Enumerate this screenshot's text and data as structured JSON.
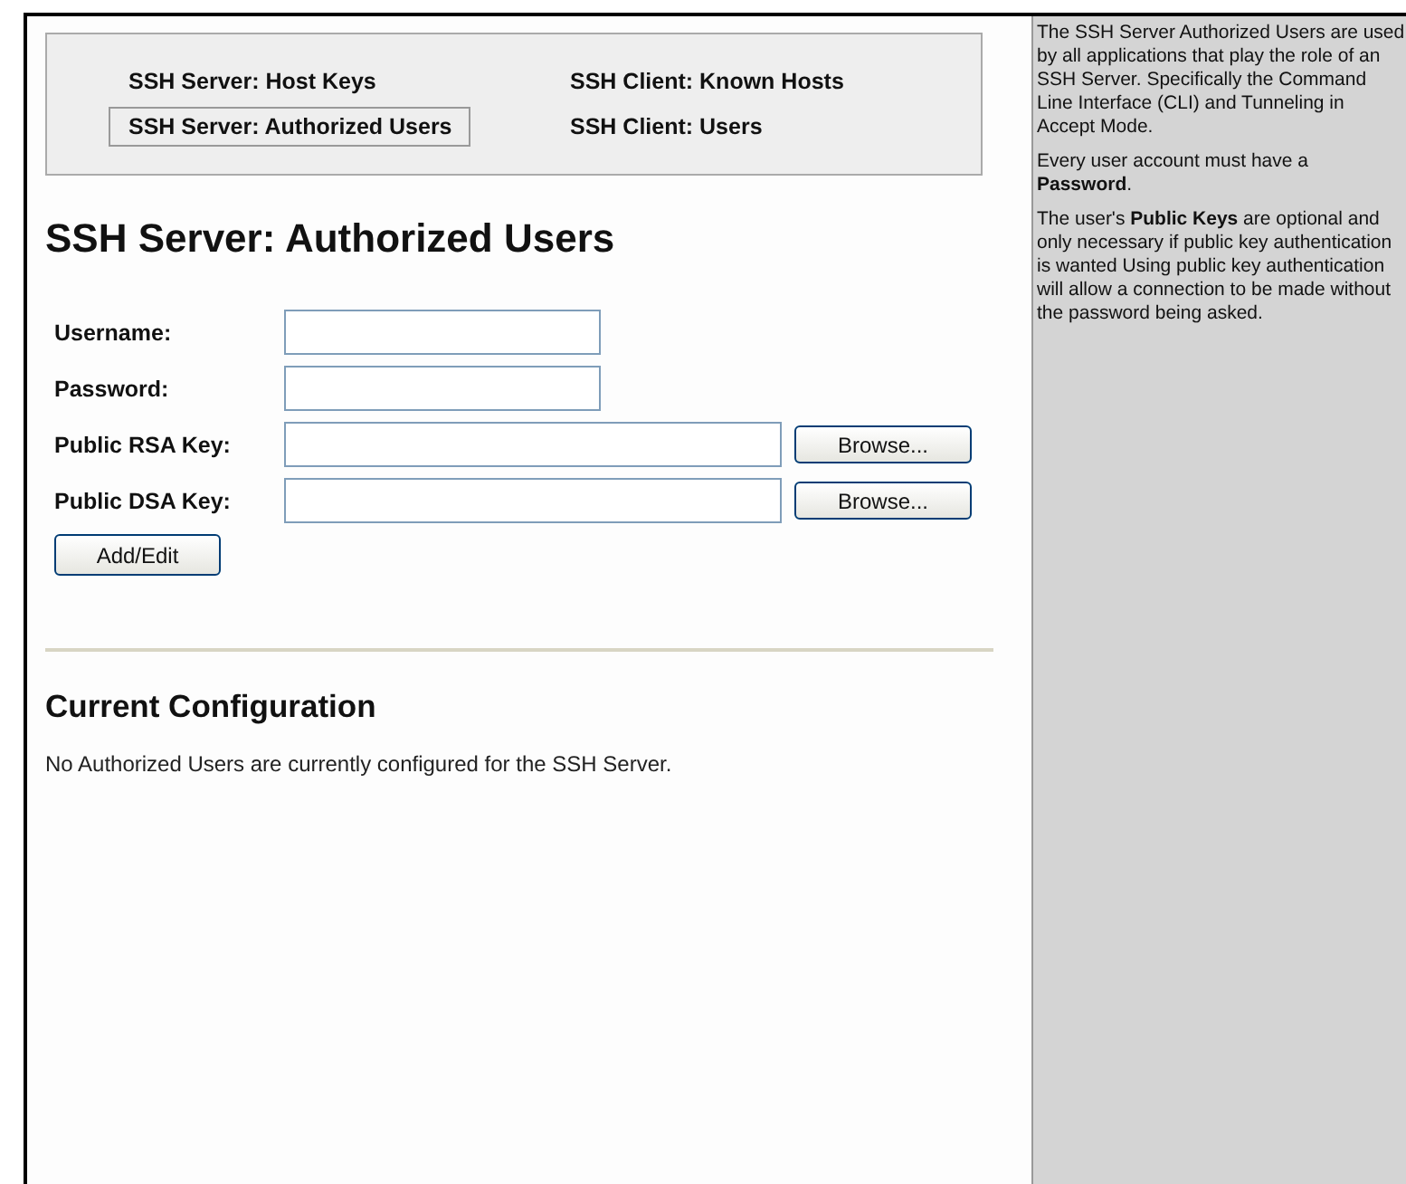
{
  "nav": [
    {
      "label": "SSH Server: Host Keys",
      "selected": false
    },
    {
      "label": "SSH Client: Known Hosts",
      "selected": false
    },
    {
      "label": "SSH Server: Authorized Users",
      "selected": true
    },
    {
      "label": "SSH Client: Users",
      "selected": false
    }
  ],
  "title": "SSH Server: Authorized Users",
  "form": {
    "fields": [
      {
        "label": "Username:",
        "kind": "text"
      },
      {
        "label": "Password:",
        "kind": "password"
      },
      {
        "label": "Public RSA Key:",
        "kind": "file",
        "button": "Browse..."
      },
      {
        "label": "Public DSA Key:",
        "kind": "file",
        "button": "Browse..."
      }
    ],
    "submit": "Add/Edit"
  },
  "config": {
    "heading": "Current Configuration",
    "message": "No Authorized Users are currently configured for the SSH Server."
  },
  "help": [
    "The SSH Server Authorized Users are used by all applications that play the role of an SSH Server. Specifically the Command Line Interface (CLI) and Tunneling in Accept Mode.",
    "Every user account must have a **Password**.",
    "The user's **Public Keys** are optional and only necessary if public key authentication is wanted Using public key authentication will allow a connection to be made without the password being asked."
  ]
}
